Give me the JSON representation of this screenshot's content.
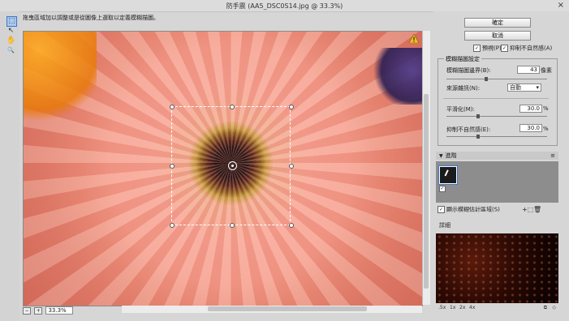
{
  "window": {
    "title": "防手震 (AA5_DSC0S14.jpg @ 33.3%)",
    "close_glyph": "×"
  },
  "tools": [
    {
      "name": "blur-trace-tool",
      "glyph": "⬚"
    },
    {
      "name": "blur-estimation-tool",
      "glyph": "↖"
    },
    {
      "name": "hand-tool",
      "glyph": "✋"
    },
    {
      "name": "zoom-tool",
      "glyph": "🔍"
    }
  ],
  "hint": "拖曳區域加以調整或是從圖像上選取以定義模糊描圖。",
  "zoom": {
    "minus": "−",
    "plus": "+",
    "value": "33.3%"
  },
  "buttons": {
    "ok": "確定",
    "cancel": "取消"
  },
  "options": {
    "preview": {
      "label": "預視(P)",
      "checked": true
    },
    "artifact": {
      "label": "抑制不自然感(A)",
      "checked": true
    }
  },
  "blur_trace": {
    "title": "模糊描圖設定",
    "bounds_label": "模糊描圖邊界(B):",
    "bounds_value": "43",
    "bounds_unit": "像素",
    "noise_label": "來源雜訊(N):",
    "noise_value": "自動",
    "smoothing_label": "平滑化(M):",
    "smoothing_value": "30.0",
    "smoothing_unit": "%",
    "artifact_label": "抑制不自然感(E):",
    "artifact_value": "30.0",
    "artifact_unit": "%"
  },
  "blur_section": {
    "title": "進階",
    "show_regions": "顯示模糊估計區域(S)"
  },
  "detail": {
    "title": "詳細",
    "zoom_labels": [
      ".5x",
      "1x",
      "2x",
      "4x"
    ]
  },
  "colors": {
    "accent": "#3a78c8",
    "panel": "#d6d6d6"
  }
}
